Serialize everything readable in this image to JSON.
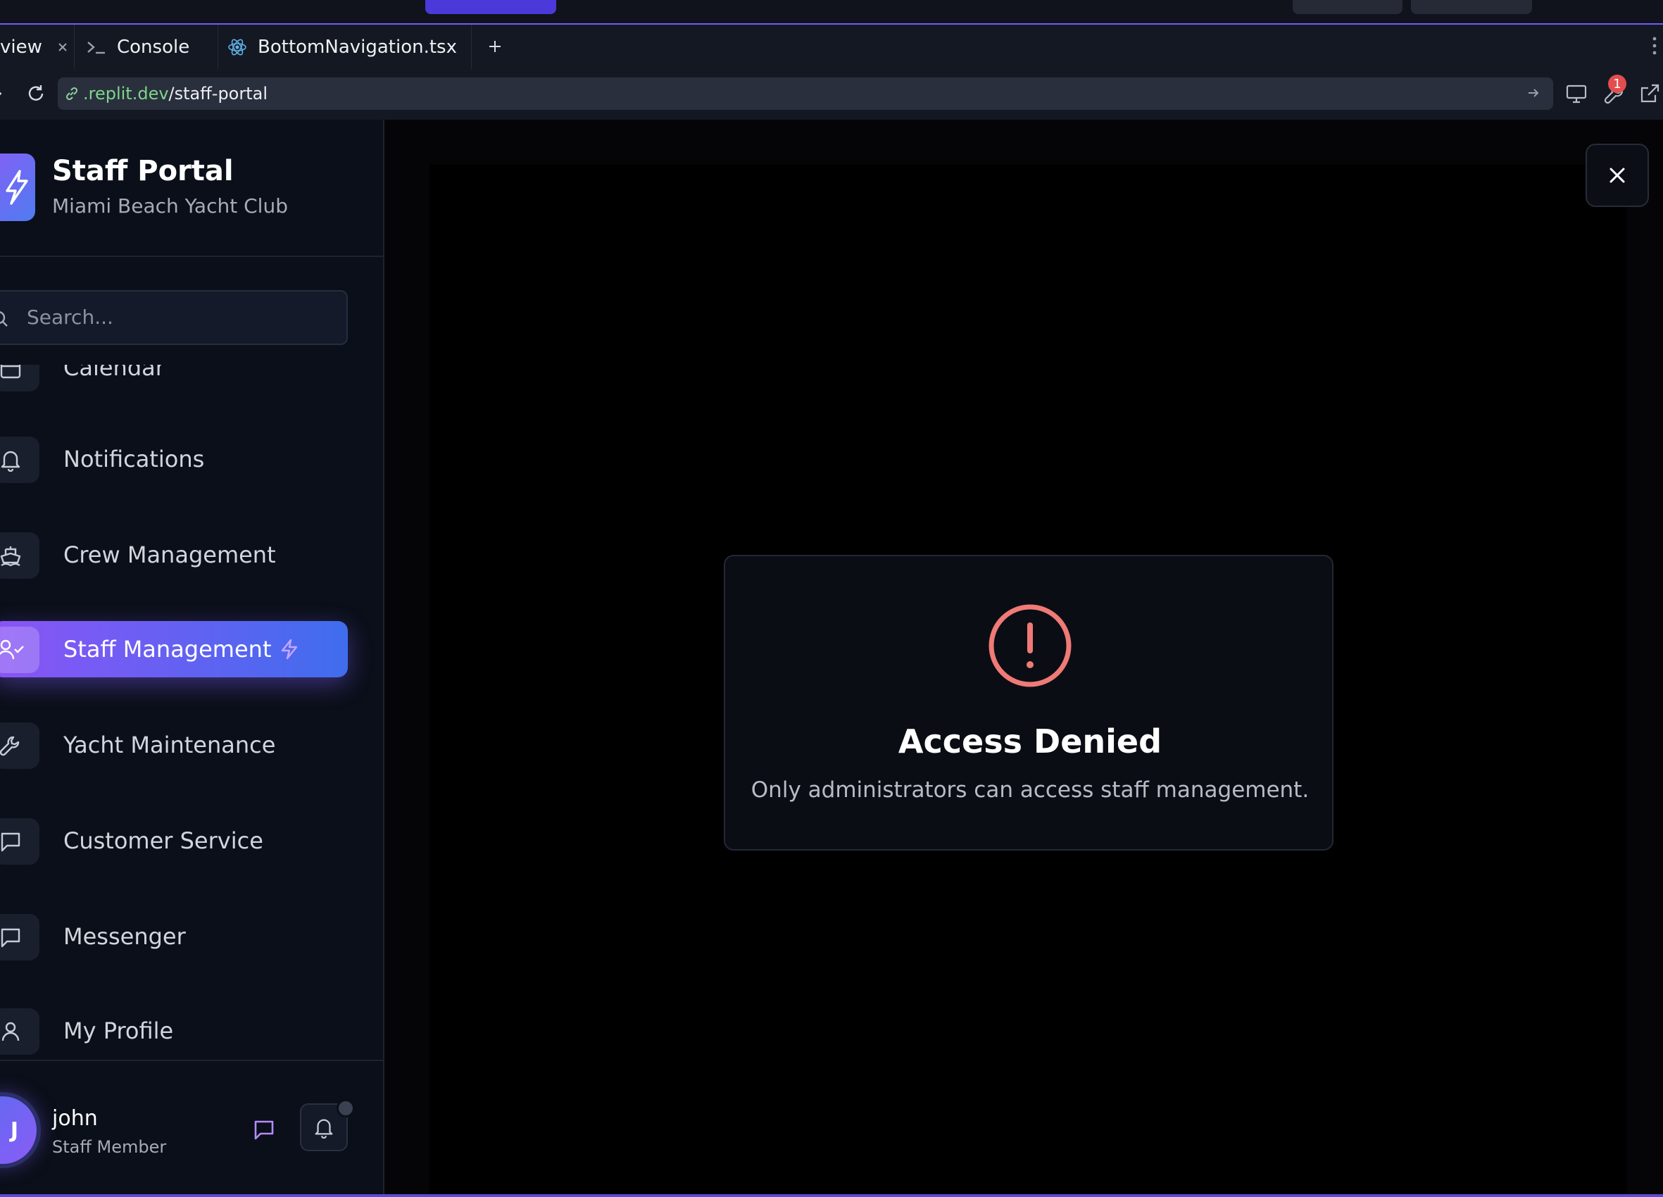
{
  "browser": {
    "tabs": [
      {
        "label": "view"
      },
      {
        "label": "Console"
      },
      {
        "label": "BottomNavigation.tsx"
      }
    ],
    "url": {
      "domain": ".replit.dev",
      "path": "/staff-portal"
    },
    "notification_count": "1"
  },
  "sidebar": {
    "brand": {
      "title": "Staff Portal",
      "subtitle": "Miami Beach Yacht Club"
    },
    "search": {
      "placeholder": "Search..."
    },
    "items": [
      {
        "label": "Calendar",
        "icon": "calendar-icon"
      },
      {
        "label": "Notifications",
        "icon": "bell-icon"
      },
      {
        "label": "Crew Management",
        "icon": "ship-icon"
      },
      {
        "label": "Staff Management",
        "icon": "user-check-icon",
        "active": true
      },
      {
        "label": "Yacht Maintenance",
        "icon": "wrench-icon"
      },
      {
        "label": "Customer Service",
        "icon": "message-square-icon"
      },
      {
        "label": "Messenger",
        "icon": "message-square-icon"
      },
      {
        "label": "My Profile",
        "icon": "user-icon"
      }
    ],
    "user": {
      "initial": "J",
      "name": "john",
      "role": "Staff Member"
    }
  },
  "main": {
    "alert": {
      "title": "Access Denied",
      "message": "Only administrators can access staff management."
    }
  },
  "colors": {
    "accent_start": "#8b54f5",
    "accent_end": "#3f6ded",
    "error": "#ef7a76",
    "url_domain": "#7ed58a"
  }
}
